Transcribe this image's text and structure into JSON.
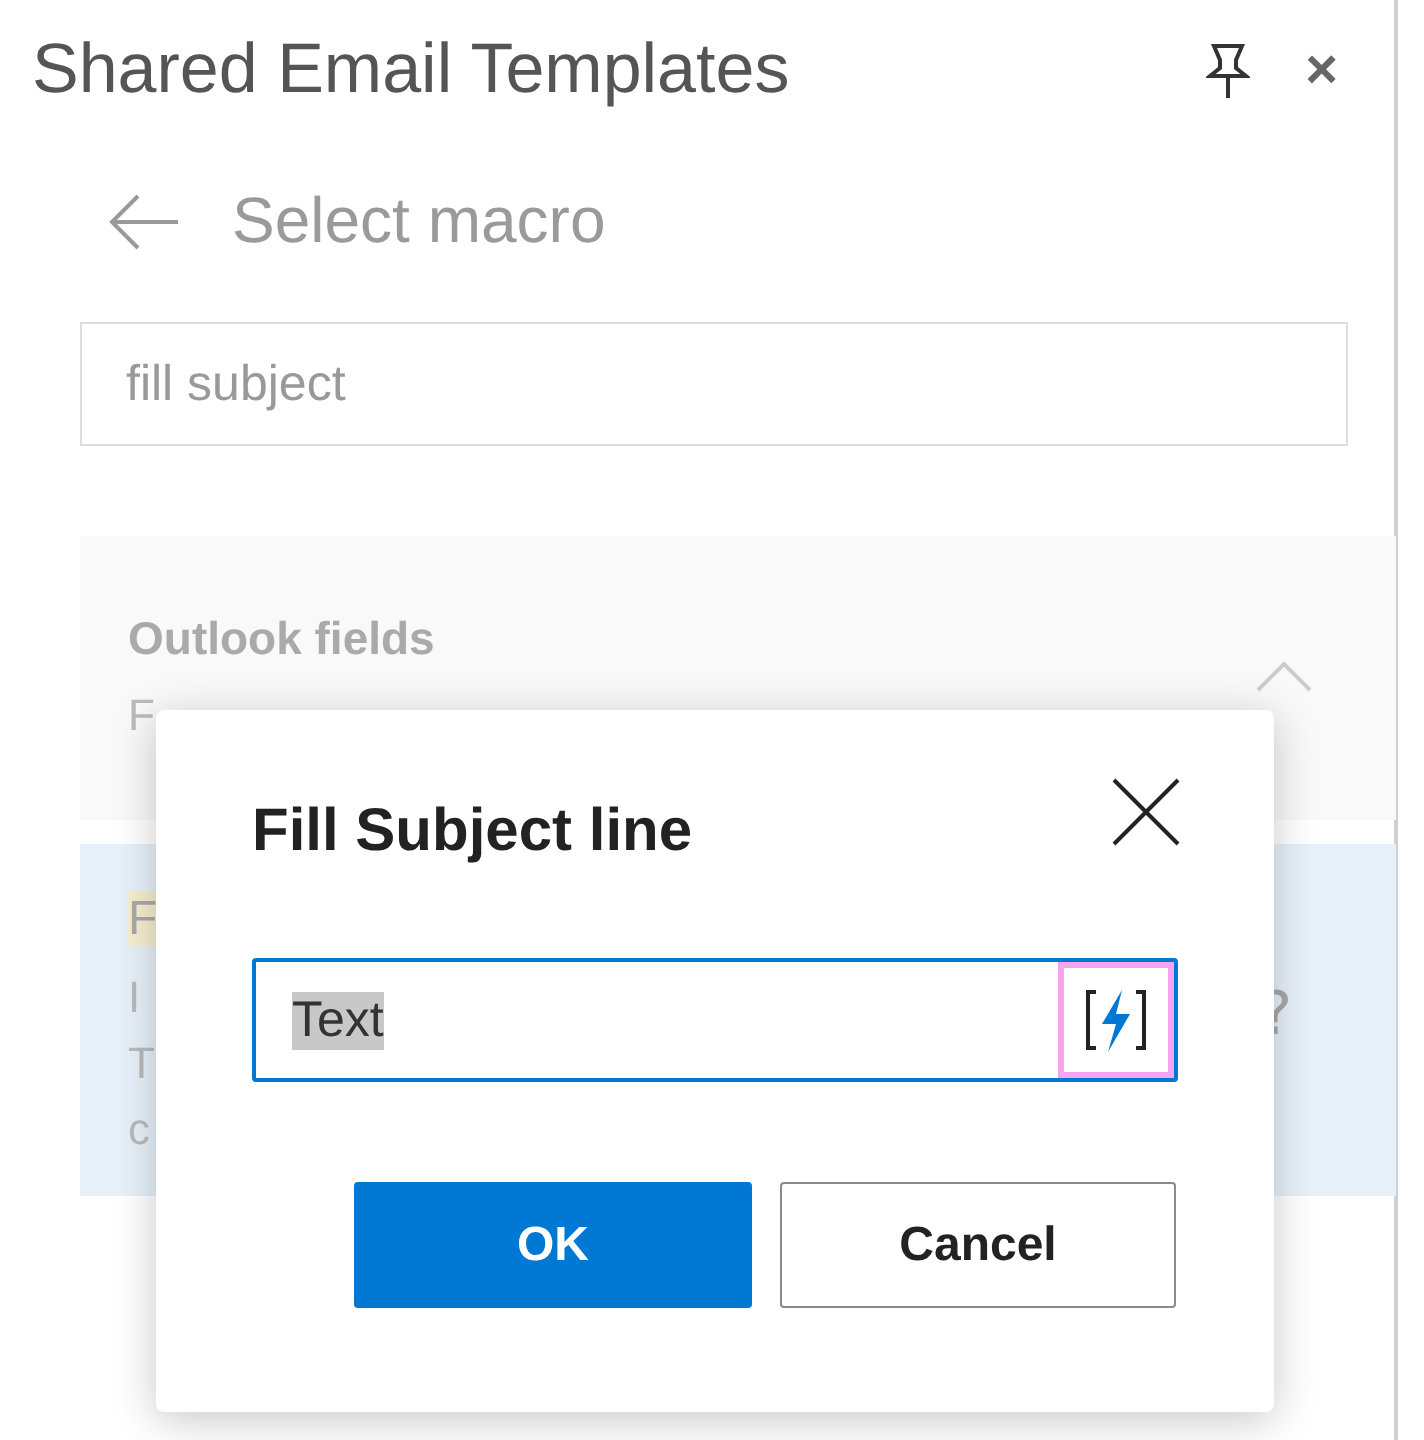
{
  "pane": {
    "title": "Shared Email Templates",
    "close_icon": "×"
  },
  "header": {
    "title": "Select macro"
  },
  "search": {
    "value": "fill subject"
  },
  "groups": [
    {
      "title": "Outlook fields",
      "subtitle": "F",
      "expanded": true,
      "items": [
        {
          "name": "F",
          "description": [
            "I",
            "T",
            "c"
          ],
          "help": "?",
          "selected": true
        }
      ]
    }
  ],
  "dialog": {
    "title": "Fill Subject line",
    "field": {
      "value": "Text"
    },
    "buttons": [
      {
        "label": "OK",
        "primary": true
      },
      {
        "label": "Cancel",
        "primary": false
      }
    ]
  }
}
